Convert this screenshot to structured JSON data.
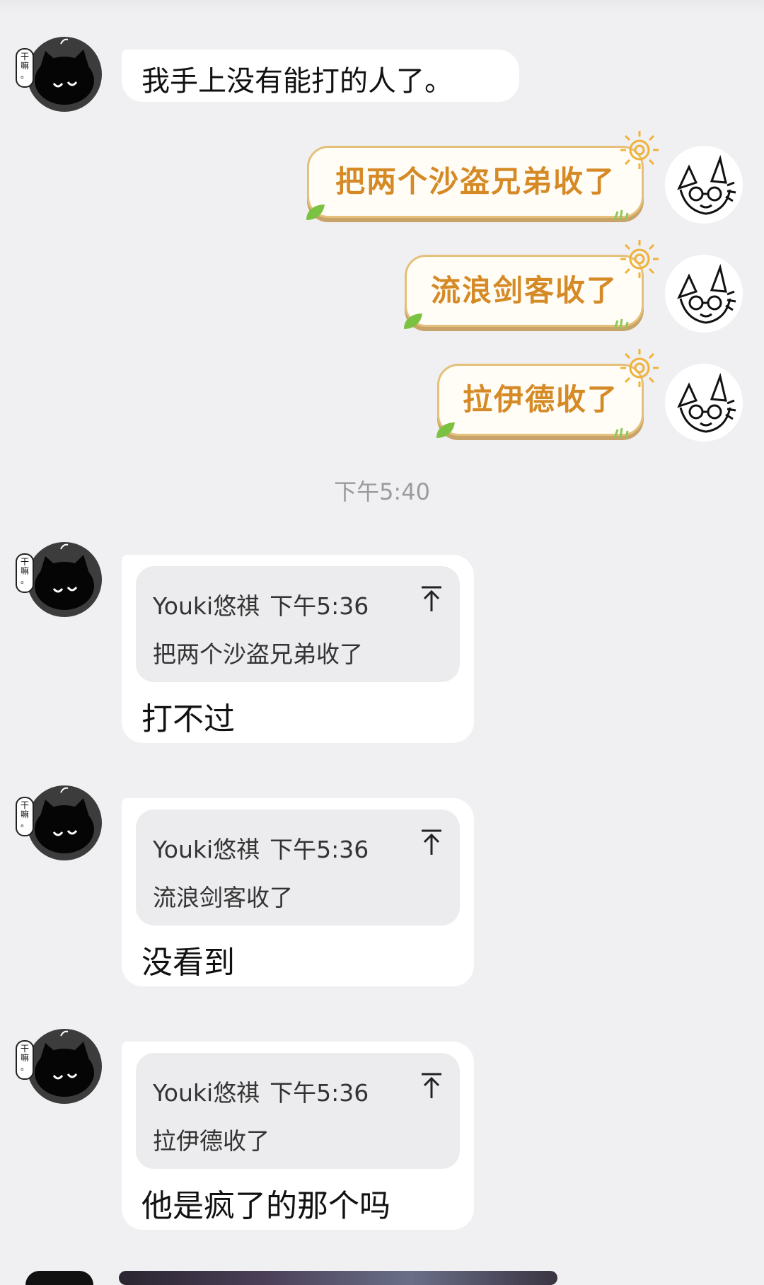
{
  "messages": {
    "m1": {
      "text": "我手上没有能打的人了。",
      "avatar_badge": "干\n嘛\n。"
    },
    "m2": {
      "text": "把两个沙盗兄弟收了"
    },
    "m3": {
      "text": "流浪剑客收了"
    },
    "m4": {
      "text": "拉伊德收了"
    },
    "timestamp": "下午5:40",
    "r1": {
      "quote_sender": "Youki悠祺",
      "quote_time": "下午5:36",
      "quote_text": "把两个沙盗兄弟收了",
      "text": "打不过"
    },
    "r2": {
      "quote_sender": "Youki悠祺",
      "quote_time": "下午5:36",
      "quote_text": "流浪剑客收了",
      "text": "没看到"
    },
    "r3": {
      "quote_sender": "Youki悠祺",
      "quote_time": "下午5:36",
      "quote_text": "拉伊德收了",
      "text": "他是疯了的那个吗"
    }
  },
  "icons": {
    "left_avatar": "black-cat-avatar-icon",
    "right_avatar": "sketch-character-avatar-icon",
    "jump_to_quote": "arrow-up-to-top-icon",
    "bubble_sun": "sun-icon",
    "bubble_leaf": "leaf-icon"
  },
  "colors": {
    "background": "#f0f0f2",
    "bubble_right_text": "#d58a26",
    "bubble_right_border": "#e4c07b",
    "timestamp": "#9a9a9f"
  }
}
